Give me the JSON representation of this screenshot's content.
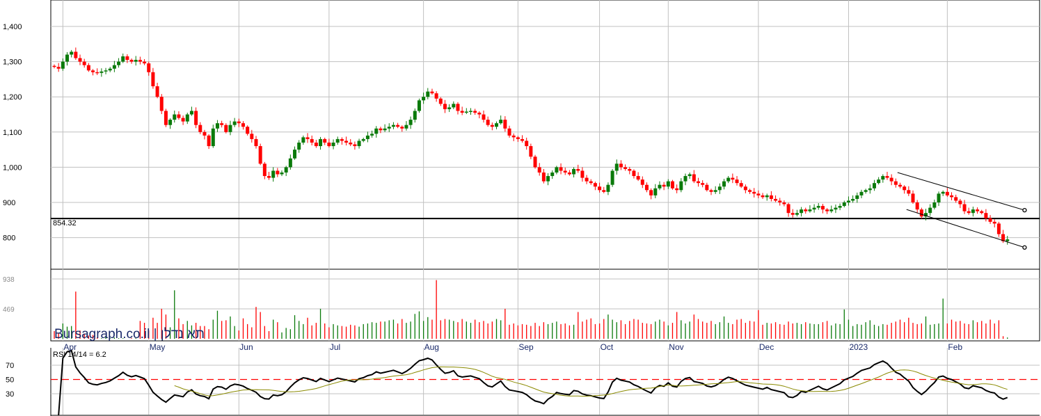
{
  "chart_data": {
    "type": "candlestick",
    "title": "",
    "watermark": "Bursagraph.co.il | תא נדלן",
    "price_ticks": [
      1400,
      1300,
      1200,
      1100,
      1000,
      900,
      800
    ],
    "price_ticks_labels": [
      "1,400",
      "1,300",
      "1,200",
      "1,100",
      "1,000",
      "900",
      "800"
    ],
    "ylim": [
      770,
      1470
    ],
    "reference_line": {
      "value": 854.32,
      "label": "854.32"
    },
    "months": [
      {
        "label": "Apr",
        "index": 2
      },
      {
        "label": "May",
        "index": 22
      },
      {
        "label": "Jun",
        "index": 43
      },
      {
        "label": "Jul",
        "index": 64
      },
      {
        "label": "Aug",
        "index": 86
      },
      {
        "label": "Sep",
        "index": 108
      },
      {
        "label": "Oct",
        "index": 127
      },
      {
        "label": "Nov",
        "index": 143
      },
      {
        "label": "Dec",
        "index": 164
      },
      {
        "label": "2023",
        "index": 185
      },
      {
        "label": "Feb",
        "index": 208
      }
    ],
    "closes": [
      1285,
      1280,
      1300,
      1320,
      1328,
      1310,
      1300,
      1290,
      1275,
      1270,
      1268,
      1272,
      1275,
      1280,
      1290,
      1300,
      1315,
      1305,
      1300,
      1305,
      1300,
      1295,
      1270,
      1230,
      1200,
      1160,
      1120,
      1135,
      1150,
      1140,
      1130,
      1150,
      1160,
      1120,
      1100,
      1090,
      1060,
      1110,
      1125,
      1120,
      1100,
      1120,
      1130,
      1125,
      1115,
      1095,
      1080,
      1060,
      1010,
      975,
      970,
      990,
      980,
      985,
      1000,
      1025,
      1050,
      1070,
      1085,
      1080,
      1070,
      1060,
      1080,
      1070,
      1060,
      1070,
      1080,
      1075,
      1070,
      1065,
      1060,
      1075,
      1080,
      1090,
      1095,
      1110,
      1105,
      1110,
      1115,
      1120,
      1115,
      1110,
      1120,
      1135,
      1160,
      1190,
      1200,
      1215,
      1210,
      1195,
      1180,
      1165,
      1170,
      1180,
      1160,
      1155,
      1158,
      1160,
      1155,
      1150,
      1135,
      1120,
      1115,
      1125,
      1135,
      1110,
      1090,
      1085,
      1080,
      1075,
      1060,
      1030,
      1000,
      985,
      960,
      975,
      985,
      1000,
      990,
      985,
      980,
      995,
      990,
      970,
      960,
      955,
      945,
      935,
      930,
      950,
      990,
      1010,
      1000,
      995,
      990,
      975,
      965,
      950,
      935,
      920,
      940,
      950,
      945,
      960,
      940,
      935,
      960,
      975,
      980,
      960,
      955,
      950,
      935,
      930,
      935,
      945,
      960,
      970,
      965,
      955,
      945,
      935,
      930,
      925,
      920,
      915,
      920,
      910,
      905,
      900,
      895,
      870,
      865,
      870,
      880,
      875,
      880,
      885,
      890,
      880,
      875,
      880,
      885,
      890,
      900,
      905,
      910,
      920,
      930,
      935,
      940,
      955,
      965,
      975,
      970,
      960,
      950,
      945,
      935,
      925,
      900,
      880,
      860,
      870,
      885,
      900,
      925,
      930,
      920,
      915,
      905,
      895,
      875,
      870,
      880,
      875,
      870,
      855,
      845,
      840,
      810,
      790,
      795
    ],
    "volume_ticks": [
      938,
      469
    ],
    "volumes": [
      120,
      90,
      240,
      190,
      200,
      740,
      130,
      80,
      50,
      60,
      20,
      10,
      40,
      10,
      20,
      10,
      10,
      0,
      10,
      10,
      280,
      250,
      130,
      330,
      250,
      470,
      380,
      180,
      760,
      320,
      230,
      280,
      210,
      250,
      200,
      200,
      150,
      300,
      440,
      280,
      290,
      350,
      200,
      130,
      320,
      230,
      180,
      500,
      420,
      200,
      120,
      300,
      260,
      100,
      170,
      150,
      370,
      280,
      230,
      330,
      210,
      250,
      470,
      240,
      180,
      230,
      210,
      200,
      190,
      220,
      210,
      190,
      230,
      240,
      260,
      250,
      270,
      270,
      290,
      300,
      240,
      310,
      250,
      270,
      390,
      430,
      280,
      340,
      300,
      920,
      290,
      310,
      300,
      280,
      260,
      310,
      270,
      250,
      300,
      260,
      280,
      240,
      270,
      310,
      290,
      470,
      220,
      240,
      210,
      230,
      220,
      200,
      250,
      200,
      260,
      230,
      250,
      270,
      230,
      240,
      210,
      220,
      420,
      270,
      300,
      320,
      230,
      240,
      310,
      380,
      300,
      260,
      290,
      230,
      280,
      310,
      300,
      250,
      240,
      230,
      270,
      300,
      270,
      210,
      250,
      420,
      290,
      240,
      270,
      380,
      310,
      270,
      250,
      280,
      230,
      260,
      350,
      250,
      230,
      300,
      310,
      250,
      280,
      270,
      450,
      220,
      250,
      240,
      260,
      230,
      220,
      270,
      240,
      250,
      230,
      260,
      240,
      230,
      230,
      260,
      280,
      210,
      240,
      230,
      460,
      300,
      200,
      230,
      220,
      260,
      290,
      220,
      200,
      230,
      220,
      250,
      270,
      300,
      260,
      330,
      250,
      230,
      240,
      350,
      220,
      230,
      240,
      630,
      240,
      300,
      270,
      280,
      240,
      230,
      290,
      260,
      280,
      240,
      300,
      240,
      290,
      40,
      20
    ],
    "up_color": "#0a7a0a",
    "down_color": "#ff0000",
    "trendlines": [
      {
        "start": {
          "index": 196.4,
          "price": 985
        },
        "end": {
          "index": 226,
          "price": 878
        }
      },
      {
        "start": {
          "index": 198.5,
          "price": 880
        },
        "end": {
          "index": 226,
          "price": 772
        }
      }
    ],
    "rsi": {
      "label": "RSI 14/14 = 6.2",
      "period": 14,
      "ma_period": 14,
      "ticks": [
        70,
        50,
        30
      ],
      "midline": 50,
      "ylim": [
        0,
        100
      ]
    }
  }
}
